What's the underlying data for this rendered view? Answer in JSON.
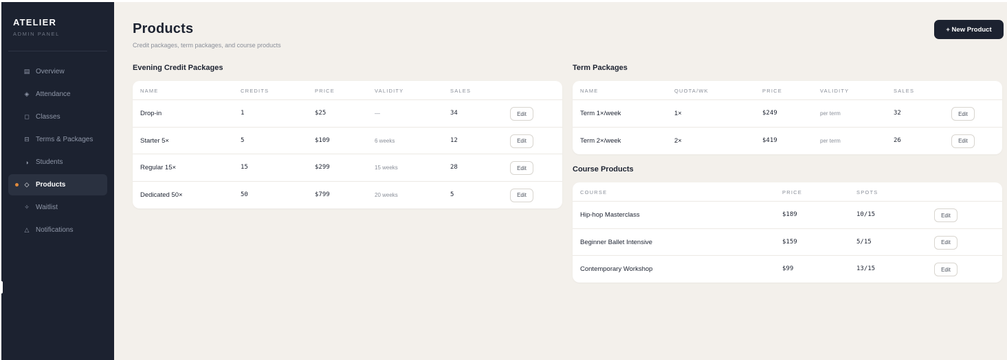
{
  "brand": {
    "name": "ATELIER",
    "subtitle": "ADMIN PANEL"
  },
  "nav": [
    {
      "label": "Overview",
      "icon": "list-icon",
      "glyph": "▤",
      "active": false
    },
    {
      "label": "Attendance",
      "icon": "diamond-dot-icon",
      "glyph": "◈",
      "active": false
    },
    {
      "label": "Classes",
      "icon": "square-icon",
      "glyph": "◻",
      "active": false
    },
    {
      "label": "Terms & Packages",
      "icon": "split-box-icon",
      "glyph": "⊟",
      "active": false
    },
    {
      "label": "Students",
      "icon": "half-circle-icon",
      "glyph": "◑",
      "active": false
    },
    {
      "label": "Products",
      "icon": "diamond-icon",
      "glyph": "◇",
      "active": true
    },
    {
      "label": "Waitlist",
      "icon": "sparkle-icon",
      "glyph": "✧",
      "active": false
    },
    {
      "label": "Notifications",
      "icon": "triangle-icon",
      "glyph": "△",
      "active": false
    }
  ],
  "header": {
    "title": "Products",
    "subtitle": "Credit packages, term packages, and course products",
    "new_button": "+ New Product"
  },
  "credit": {
    "title": "Evening Credit Packages",
    "columns": [
      "NAME",
      "CREDITS",
      "PRICE",
      "VALIDITY",
      "SALES"
    ],
    "rows": [
      {
        "name": "Drop-in",
        "credits": "1",
        "price": "$25",
        "validity": "—",
        "sales": "34",
        "action": "Edit"
      },
      {
        "name": "Starter 5×",
        "credits": "5",
        "price": "$109",
        "validity": "6 weeks",
        "sales": "12",
        "action": "Edit"
      },
      {
        "name": "Regular 15×",
        "credits": "15",
        "price": "$299",
        "validity": "15 weeks",
        "sales": "28",
        "action": "Edit"
      },
      {
        "name": "Dedicated 50×",
        "credits": "50",
        "price": "$799",
        "validity": "20 weeks",
        "sales": "5",
        "action": "Edit"
      }
    ]
  },
  "term": {
    "title": "Term Packages",
    "columns": [
      "NAME",
      "QUOTA/WK",
      "PRICE",
      "VALIDITY",
      "SALES"
    ],
    "rows": [
      {
        "name": "Term 1×/week",
        "quota": "1×",
        "price": "$249",
        "validity": "per term",
        "sales": "32",
        "action": "Edit"
      },
      {
        "name": "Term 2×/week",
        "quota": "2×",
        "price": "$419",
        "validity": "per term",
        "sales": "26",
        "action": "Edit"
      }
    ]
  },
  "course": {
    "title": "Course Products",
    "columns": [
      "COURSE",
      "PRICE",
      "SPOTS"
    ],
    "rows": [
      {
        "name": "Hip-hop Masterclass",
        "price": "$189",
        "spots": "10/15",
        "action": "Edit"
      },
      {
        "name": "Beginner Ballet Intensive",
        "price": "$159",
        "spots": "5/15",
        "action": "Edit"
      },
      {
        "name": "Contemporary Workshop",
        "price": "$99",
        "spots": "13/15",
        "action": "Edit"
      }
    ]
  },
  "colors": {
    "sidebar": "#1c2230",
    "background": "#f3f0eb",
    "accent": "#e08a3c",
    "card": "#ffffff"
  }
}
